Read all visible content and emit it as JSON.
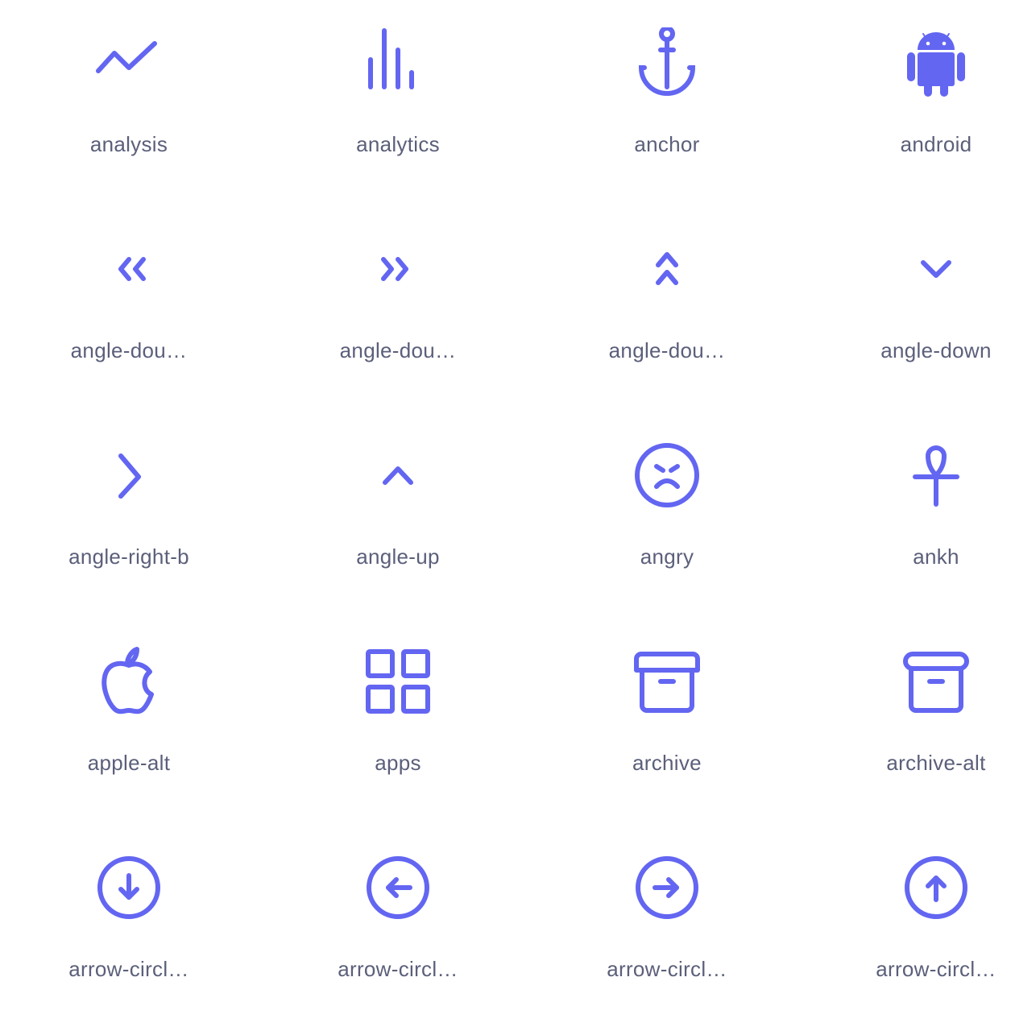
{
  "colors": {
    "icon": "#6366f1",
    "label": "#5b5f7a",
    "background": "#ffffff"
  },
  "icons": [
    {
      "name": "analysis",
      "label": "analysis",
      "icon": "analysis-icon"
    },
    {
      "name": "analytics",
      "label": "analytics",
      "icon": "analytics-icon"
    },
    {
      "name": "anchor",
      "label": "anchor",
      "icon": "anchor-icon"
    },
    {
      "name": "android",
      "label": "android",
      "icon": "android-icon"
    },
    {
      "name": "angle-double-left",
      "label": "angle-dou…",
      "icon": "angle-double-left-icon"
    },
    {
      "name": "angle-double-right",
      "label": "angle-dou…",
      "icon": "angle-double-right-icon"
    },
    {
      "name": "angle-double-up",
      "label": "angle-dou…",
      "icon": "angle-double-up-icon"
    },
    {
      "name": "angle-down",
      "label": "angle-down",
      "icon": "angle-down-icon"
    },
    {
      "name": "angle-right-b",
      "label": "angle-right-b",
      "icon": "angle-right-b-icon"
    },
    {
      "name": "angle-up",
      "label": "angle-up",
      "icon": "angle-up-icon"
    },
    {
      "name": "angry",
      "label": "angry",
      "icon": "angry-icon"
    },
    {
      "name": "ankh",
      "label": "ankh",
      "icon": "ankh-icon"
    },
    {
      "name": "apple-alt",
      "label": "apple-alt",
      "icon": "apple-alt-icon"
    },
    {
      "name": "apps",
      "label": "apps",
      "icon": "apps-icon"
    },
    {
      "name": "archive",
      "label": "archive",
      "icon": "archive-icon"
    },
    {
      "name": "archive-alt",
      "label": "archive-alt",
      "icon": "archive-alt-icon"
    },
    {
      "name": "arrow-circle-down",
      "label": "arrow-circl…",
      "icon": "arrow-circle-down-icon"
    },
    {
      "name": "arrow-circle-left",
      "label": "arrow-circl…",
      "icon": "arrow-circle-left-icon"
    },
    {
      "name": "arrow-circle-right",
      "label": "arrow-circl…",
      "icon": "arrow-circle-right-icon"
    },
    {
      "name": "arrow-circle-up",
      "label": "arrow-circl…",
      "icon": "arrow-circle-up-icon"
    }
  ]
}
